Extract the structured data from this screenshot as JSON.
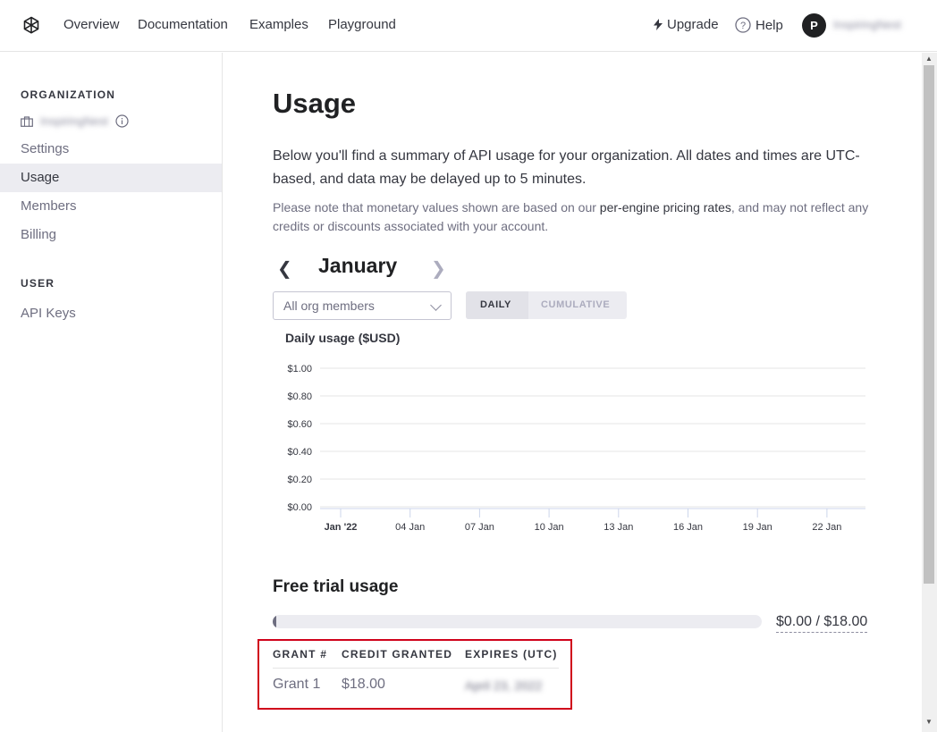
{
  "nav": {
    "links": [
      "Overview",
      "Documentation",
      "Examples",
      "Playground"
    ],
    "upgrade": "Upgrade",
    "help": "Help",
    "avatar_initial": "P",
    "username": "InspiringNest"
  },
  "sidebar": {
    "org_heading": "ORGANIZATION",
    "org_name": "InspiringNest",
    "org_items": [
      {
        "label": "Settings",
        "active": false
      },
      {
        "label": "Usage",
        "active": true
      },
      {
        "label": "Members",
        "active": false
      },
      {
        "label": "Billing",
        "active": false
      }
    ],
    "user_heading": "USER",
    "user_items": [
      {
        "label": "API Keys",
        "active": false
      }
    ]
  },
  "main": {
    "title": "Usage",
    "intro": "Below you'll find a summary of API usage for your organization. All dates and times are UTC-based, and data may be delayed up to 5 minutes.",
    "note_prefix": "Please note that monetary values shown are based on our ",
    "note_link": "per-engine pricing rates",
    "note_suffix": ", and may not reflect any credits or discounts associated with your account.",
    "month": "January",
    "member_filter": "All org members",
    "toggle": {
      "daily": "DAILY",
      "cumulative": "CUMULATIVE",
      "selected": "daily"
    }
  },
  "chart_data": {
    "type": "bar",
    "title": "Daily usage ($USD)",
    "xlabel": "",
    "ylabel": "",
    "y_ticks": [
      "$1.00",
      "$0.80",
      "$0.60",
      "$0.40",
      "$0.20",
      "$0.00"
    ],
    "ylim": [
      0,
      1
    ],
    "x_ticks": [
      "Jan '22",
      "04 Jan",
      "07 Jan",
      "10 Jan",
      "13 Jan",
      "16 Jan",
      "19 Jan",
      "22 Jan"
    ],
    "grid": true,
    "series": [
      {
        "values": []
      }
    ]
  },
  "free_trial": {
    "title": "Free trial usage",
    "used": 0,
    "total": 18,
    "label": "$0.00 / $18.00",
    "columns": [
      "GRANT #",
      "CREDIT GRANTED",
      "EXPIRES (UTC)"
    ],
    "rows": [
      [
        "Grant 1",
        "$18.00",
        "April 23, 2022"
      ]
    ]
  },
  "colors": {
    "accent_highlight": "#d0021b",
    "sidebar_active_bg": "#ececf1"
  }
}
